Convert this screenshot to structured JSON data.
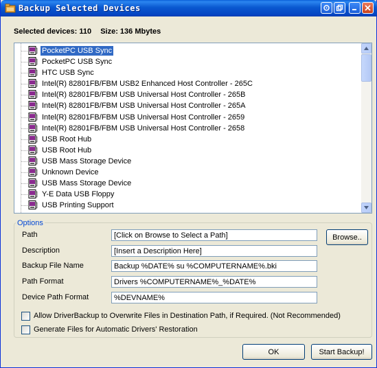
{
  "window": {
    "title": "Backup Selected Devices"
  },
  "summary": {
    "selected_devices": "Selected devices: 110",
    "size": "Size: 136 Mbytes"
  },
  "device_list": {
    "items": [
      {
        "label": "PocketPC USB Sync",
        "selected": true
      },
      {
        "label": "PocketPC USB Sync",
        "selected": false
      },
      {
        "label": "HTC USB Sync",
        "selected": false
      },
      {
        "label": "Intel(R) 82801FB/FBM USB2 Enhanced Host Controller - 265C",
        "selected": false
      },
      {
        "label": "Intel(R) 82801FB/FBM USB Universal Host Controller - 265B",
        "selected": false
      },
      {
        "label": "Intel(R) 82801FB/FBM USB Universal Host Controller - 265A",
        "selected": false
      },
      {
        "label": "Intel(R) 82801FB/FBM USB Universal Host Controller - 2659",
        "selected": false
      },
      {
        "label": "Intel(R) 82801FB/FBM USB Universal Host Controller - 2658",
        "selected": false
      },
      {
        "label": "USB Root Hub",
        "selected": false
      },
      {
        "label": "USB Root Hub",
        "selected": false
      },
      {
        "label": "USB Mass Storage Device",
        "selected": false
      },
      {
        "label": "Unknown Device",
        "selected": false
      },
      {
        "label": "USB Mass Storage Device",
        "selected": false
      },
      {
        "label": "Y-E Data USB Floppy",
        "selected": false
      },
      {
        "label": "USB Printing Support",
        "selected": false
      }
    ]
  },
  "options": {
    "legend": "Options",
    "path_label": "Path",
    "path_value": "[Click on Browse to Select a Path]",
    "browse_label": "Browse..",
    "description_label": "Description",
    "description_value": "[Insert a Description Here]",
    "backup_file_name_label": "Backup File Name",
    "backup_file_name_value": "Backup %DATE% su %COMPUTERNAME%.bki",
    "path_format_label": "Path Format",
    "path_format_value": "Drivers %COMPUTERNAME%_%DATE%",
    "device_path_format_label": "Device Path Format",
    "device_path_format_value": "%DEVNAME%",
    "overwrite_label": "Allow DriverBackup to Overwrite Files in Destination Path, if Required. (Not Recommended)",
    "overwrite_checked": false,
    "restore_files_label": "Generate Files for Automatic Drivers' Restoration",
    "restore_files_checked": false
  },
  "buttons": {
    "ok_label": "OK",
    "start_backup_label": "Start Backup!"
  },
  "colors": {
    "titlebar": "#0a58d0",
    "selection": "#316ac5",
    "legend_text": "#0046d5",
    "dialog_bg": "#ece9d8"
  }
}
